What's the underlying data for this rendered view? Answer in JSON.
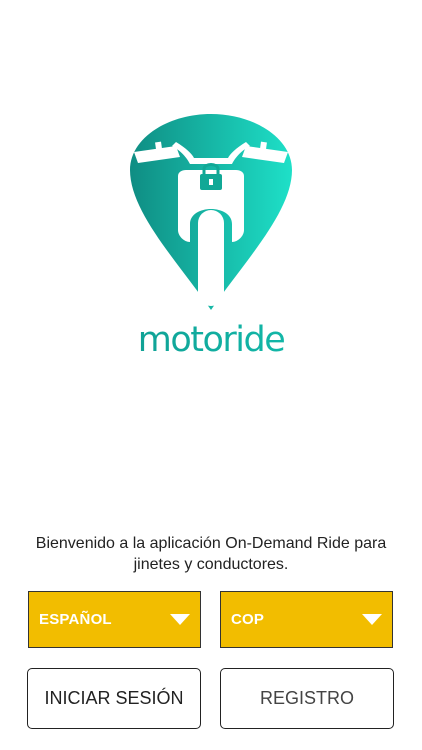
{
  "brand": {
    "name": "motoride",
    "colors": {
      "teal_dark": "#0f8d83",
      "teal_light": "#1ee0c8"
    }
  },
  "welcome_text": "Bienvenido a la aplicación On-Demand Ride para jinetes y conductores.",
  "selectors": {
    "language": {
      "value": "ESPAÑOL",
      "icon": "caret-down-icon"
    },
    "currency": {
      "value": "COP",
      "icon": "caret-down-icon"
    },
    "color": "#f2bd00"
  },
  "buttons": {
    "login": "INICIAR SESIÓN",
    "register": "REGISTRO"
  }
}
